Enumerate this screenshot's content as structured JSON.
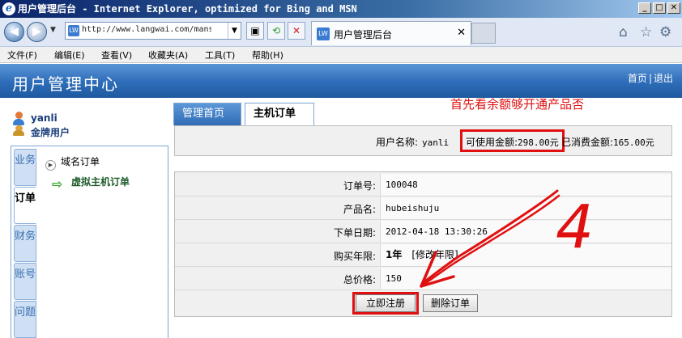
{
  "browser": {
    "title": "用户管理后台 - Internet Explorer, optimized for Bing and MSN",
    "url": "http://www.langwai.com/mans",
    "tab_label": "用户管理后台",
    "tab_close": "✕",
    "win_min": "_",
    "win_max": "□",
    "win_close": "✕"
  },
  "menu": [
    "文件(F)",
    "编辑(E)",
    "查看(V)",
    "收藏夹(A)",
    "工具(T)",
    "帮助(H)"
  ],
  "header": {
    "title": "用户管理中心",
    "home_link": "首页",
    "separator": "|",
    "logout_link": "退出"
  },
  "user": {
    "name": "yanli",
    "level": "金牌用户"
  },
  "sidebar": {
    "tabs": [
      "业务",
      "订单",
      "财务",
      "账号",
      "问题"
    ],
    "active_tab": "订单",
    "items": [
      "域名订单",
      "虚拟主机订单"
    ]
  },
  "content_tabs": [
    "管理首页",
    "主机订单"
  ],
  "annotation": {
    "note": "首先看余额够开通产品否",
    "step": "4"
  },
  "balance": {
    "user_label": "用户名称:",
    "user_value": "yanli",
    "available_label": "可使用金额:",
    "available_value": "298.00元",
    "spent_label": "已消费金额:",
    "spent_value": "165.00元"
  },
  "order": {
    "rows": [
      {
        "label": "订单号:",
        "value": "100048"
      },
      {
        "label": "产品名:",
        "value": "hubeishuju"
      },
      {
        "label": "下单日期:",
        "value": "2012-04-18 13:30:26"
      },
      {
        "label": "购买年限:",
        "value": "1年",
        "link": "[修改年限]"
      },
      {
        "label": "总价格:",
        "value": "150"
      }
    ],
    "register_button": "立即注册",
    "delete_button": "删除订单"
  },
  "colors": {
    "header_blue": "#2d6cb8",
    "annotation_red": "#e01010",
    "panel_border": "#7ea4d4"
  }
}
